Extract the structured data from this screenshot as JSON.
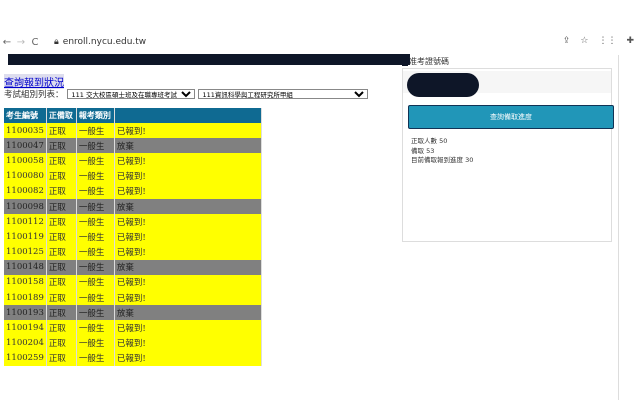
{
  "browser": {
    "url": "enroll.nycu.edu.tw",
    "back": "←",
    "forward": "→",
    "reload": "C"
  },
  "page": {
    "title": "查詢報到狀況",
    "filter_label": "考試組別列表：",
    "select1": "111 交大校區碩士班及在職專班考試",
    "select2": "111資訊科學與工程研究所甲組"
  },
  "table": {
    "headers": [
      "考生編號",
      "正備取",
      "報考類別",
      ""
    ],
    "rows": [
      {
        "id": "1100035",
        "type": "正取",
        "cat": "一般生",
        "status": "已報到!",
        "state": "reported"
      },
      {
        "id": "1100047",
        "type": "正取",
        "cat": "一般生",
        "status": "放棄",
        "state": "waived"
      },
      {
        "id": "1100058",
        "type": "正取",
        "cat": "一般生",
        "status": "已報到!",
        "state": "reported"
      },
      {
        "id": "1100080",
        "type": "正取",
        "cat": "一般生",
        "status": "已報到!",
        "state": "reported"
      },
      {
        "id": "1100082",
        "type": "正取",
        "cat": "一般生",
        "status": "已報到!",
        "state": "reported"
      },
      {
        "id": "1100098",
        "type": "正取",
        "cat": "一般生",
        "status": "放棄",
        "state": "waived"
      },
      {
        "id": "1100112",
        "type": "正取",
        "cat": "一般生",
        "status": "已報到!",
        "state": "reported"
      },
      {
        "id": "1100119",
        "type": "正取",
        "cat": "一般生",
        "status": "已報到!",
        "state": "reported"
      },
      {
        "id": "1100125",
        "type": "正取",
        "cat": "一般生",
        "status": "已報到!",
        "state": "reported"
      },
      {
        "id": "1100148",
        "type": "正取",
        "cat": "一般生",
        "status": "放棄",
        "state": "waived"
      },
      {
        "id": "1100158",
        "type": "正取",
        "cat": "一般生",
        "status": "已報到!",
        "state": "reported"
      },
      {
        "id": "1100189",
        "type": "正取",
        "cat": "一般生",
        "status": "已報到!",
        "state": "reported"
      },
      {
        "id": "1100193",
        "type": "正取",
        "cat": "一般生",
        "status": "放棄",
        "state": "waived"
      },
      {
        "id": "1100194",
        "type": "正取",
        "cat": "一般生",
        "status": "已報到!",
        "state": "reported"
      },
      {
        "id": "1100204",
        "type": "正取",
        "cat": "一般生",
        "status": "已報到!",
        "state": "reported"
      },
      {
        "id": "1100259",
        "type": "正取",
        "cat": "一般生",
        "status": "已報到!",
        "state": "reported"
      }
    ]
  },
  "panel": {
    "label": "准考證號碼",
    "button": "查詢備取進度",
    "stats": [
      "正取人數 50",
      "備取 53",
      "目前備取報到進度 30"
    ]
  },
  "colors": {
    "header": "#0f6a92",
    "reported": "#ffff00",
    "waived": "#808080",
    "button": "#2196b8"
  }
}
